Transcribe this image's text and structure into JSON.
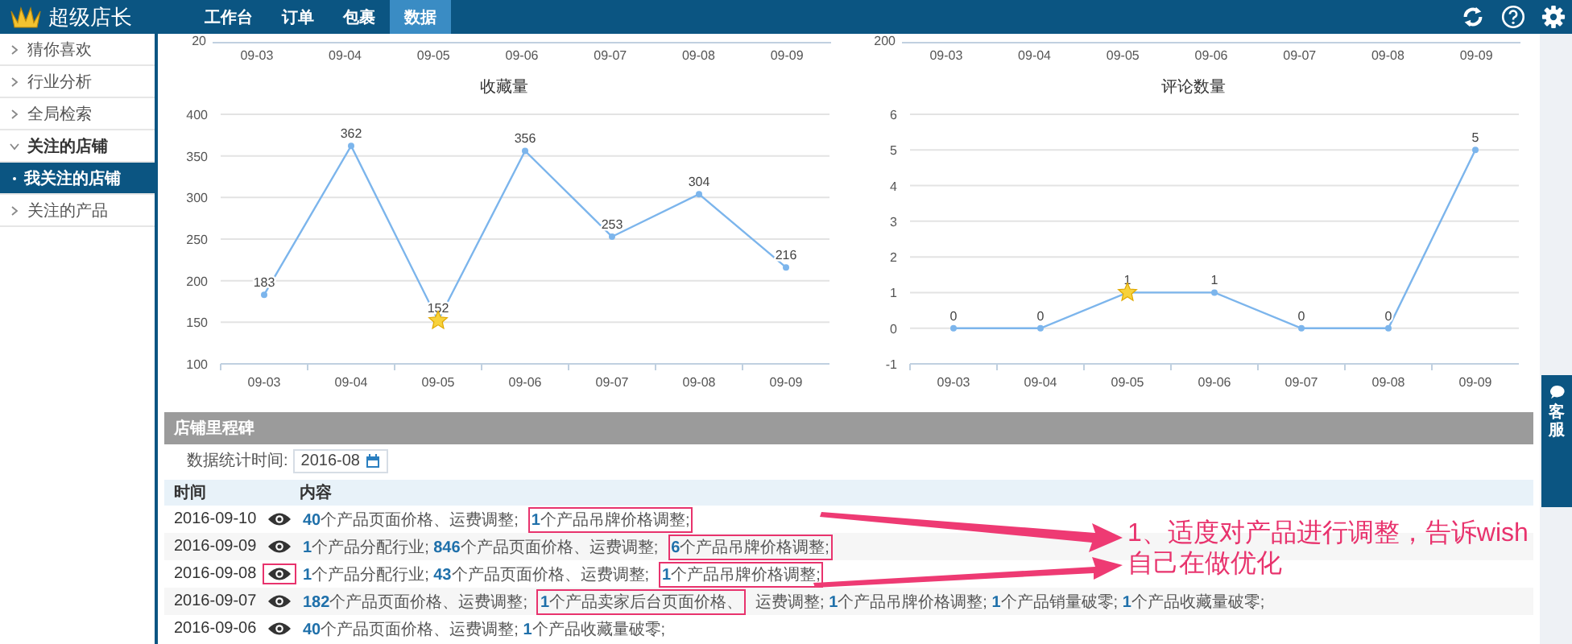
{
  "app": {
    "logo": "超级店长"
  },
  "nav_tabs": [
    {
      "label": "工作台",
      "selected": false
    },
    {
      "label": "订单",
      "selected": false
    },
    {
      "label": "包裹",
      "selected": false
    },
    {
      "label": "数据",
      "selected": true
    }
  ],
  "sidebar": {
    "items": [
      {
        "label": "猜你喜欢",
        "expanded": false,
        "selected": false
      },
      {
        "label": "行业分析",
        "expanded": false,
        "selected": false
      },
      {
        "label": "全局检索",
        "expanded": false,
        "selected": false
      },
      {
        "label": "关注的店铺",
        "expanded": true,
        "selected": false,
        "children": [
          {
            "label": "我关注的店铺",
            "selected": true
          }
        ]
      },
      {
        "label": "关注的产品",
        "expanded": false,
        "selected": false
      }
    ]
  },
  "upper_axes": [
    {
      "y_tick": "20",
      "x_labels": [
        "09-03",
        "09-04",
        "09-05",
        "09-06",
        "09-07",
        "09-08",
        "09-09"
      ]
    },
    {
      "y_tick": "200",
      "x_labels": [
        "09-03",
        "09-04",
        "09-05",
        "09-06",
        "09-07",
        "09-08",
        "09-09"
      ]
    }
  ],
  "charts": [
    {
      "chart_data": {
        "type": "line",
        "title": "收藏量",
        "categories": [
          "09-03",
          "09-04",
          "09-05",
          "09-06",
          "09-07",
          "09-08",
          "09-09"
        ],
        "series": [
          {
            "color": "#7cb5ec",
            "marker": "circle",
            "values": [
              183,
              362,
              152,
              356,
              253,
              304,
              216
            ]
          }
        ],
        "ylim": [
          100,
          400
        ],
        "yticks": [
          100,
          150,
          200,
          250,
          300,
          350,
          400
        ],
        "grid": true,
        "data_labels": true
      },
      "points": [
        {
          "starred": false
        },
        {
          "starred": false
        },
        {
          "starred": true
        },
        {
          "starred": false
        },
        {
          "starred": false
        },
        {
          "starred": false
        },
        {
          "starred": false
        }
      ]
    },
    {
      "chart_data": {
        "type": "line",
        "title": "评论数量",
        "categories": [
          "09-03",
          "09-04",
          "09-05",
          "09-06",
          "09-07",
          "09-08",
          "09-09"
        ],
        "series": [
          {
            "color": "#7cb5ec",
            "marker": "circle",
            "values": [
              0,
              0,
              1,
              1,
              0,
              0,
              5
            ]
          }
        ],
        "ylim": [
          -1,
          6
        ],
        "yticks": [
          -1,
          0,
          1,
          2,
          3,
          4,
          5,
          6
        ],
        "grid": true,
        "data_labels": true
      },
      "points": [
        {
          "starred": false
        },
        {
          "starred": false
        },
        {
          "starred": true
        },
        {
          "starred": false
        },
        {
          "starred": false
        },
        {
          "starred": false
        },
        {
          "starred": false
        }
      ]
    }
  ],
  "milestones": {
    "title": "店铺里程碑",
    "filter_label": "数据统计时间:",
    "filter_value": "2016-08",
    "columns": [
      "时间",
      "内容"
    ],
    "rows": [
      {
        "time": "2016-09-10",
        "eye_highlighted": false,
        "segments": [
          {
            "text": "**40**个产品页面价格、运费调整;",
            "boxed": false
          },
          {
            "text": "**1**个产品吊牌价格调整;",
            "boxed": true
          }
        ]
      },
      {
        "time": "2016-09-09",
        "eye_highlighted": false,
        "segments": [
          {
            "text": "**1**个产品分配行业; **846**个产品页面价格、运费调整;",
            "boxed": false
          },
          {
            "text": "**6**个产品吊牌价格调整;",
            "boxed": true
          }
        ]
      },
      {
        "time": "2016-09-08",
        "eye_highlighted": true,
        "segments": [
          {
            "text": "**1**个产品分配行业; **43**个产品页面价格、运费调整;",
            "boxed": false
          },
          {
            "text": "**1**个产品吊牌价格调整;",
            "boxed": true
          }
        ]
      },
      {
        "time": "2016-09-07",
        "eye_highlighted": false,
        "segments": [
          {
            "text": "**182**个产品页面价格、运费调整;",
            "boxed": false
          },
          {
            "text": "**1**个产品卖家后台页面价格、",
            "boxed": true
          },
          {
            "text": "运费调整; **1**个产品吊牌价格调整; **1**个产品销量破零; **1**个产品收藏量破零;",
            "boxed": false
          }
        ]
      },
      {
        "time": "2016-09-06",
        "eye_highlighted": false,
        "segments": [
          {
            "text": "**40**个产品页面价格、运费调整; **1**个产品收藏量破零;",
            "boxed": false
          }
        ]
      }
    ]
  },
  "service_tab": {
    "label": "客服"
  },
  "annotation": {
    "text": "1、适度对产品进行调整，告诉wish自己在做优化"
  }
}
